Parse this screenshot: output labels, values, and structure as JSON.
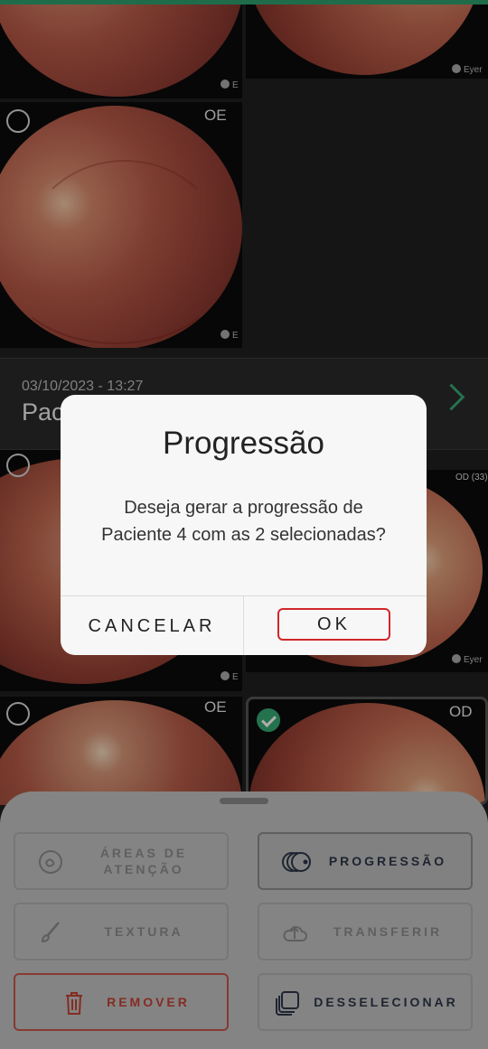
{
  "theme": {
    "accent": "#2fa06f",
    "danger": "#c34234",
    "sheet_bg": "#c3c3c3"
  },
  "images": [
    {
      "eye": "",
      "selected": false,
      "brand": "E"
    },
    {
      "eye": "",
      "selected": false,
      "brand": "Eyer"
    },
    {
      "eye": "OE",
      "selected": false,
      "brand": "E"
    },
    {
      "eye": "",
      "selected": false,
      "brand": "E"
    },
    {
      "eye": "OD (33)",
      "selected": false,
      "brand": "Eyer"
    },
    {
      "eye": "OE",
      "selected": false,
      "brand": ""
    },
    {
      "eye": "OD",
      "selected": true,
      "brand": ""
    }
  ],
  "session": {
    "date": "03/10/2023 - 13:27",
    "name": "Pac"
  },
  "dialog": {
    "title": "Progressão",
    "message_line1": "Deseja gerar a progressão de",
    "message_line2": "Paciente 4 com as 2 selecionadas?",
    "cancel": "CANCELAR",
    "ok": "OK"
  },
  "actions": {
    "areas": {
      "label": "ÁREAS DE ATENÇÃO",
      "icon": "palette-icon"
    },
    "progressao": {
      "label": "PROGRESSÃO",
      "icon": "stacked-circles-icon"
    },
    "textura": {
      "label": "TEXTURA",
      "icon": "brush-icon"
    },
    "transferir": {
      "label": "TRANSFERIR",
      "icon": "cloud-upload-icon"
    },
    "remover": {
      "label": "REMOVER",
      "icon": "trash-icon"
    },
    "desselecionar": {
      "label": "DESSELECIONAR",
      "icon": "stacked-squares-icon"
    }
  }
}
